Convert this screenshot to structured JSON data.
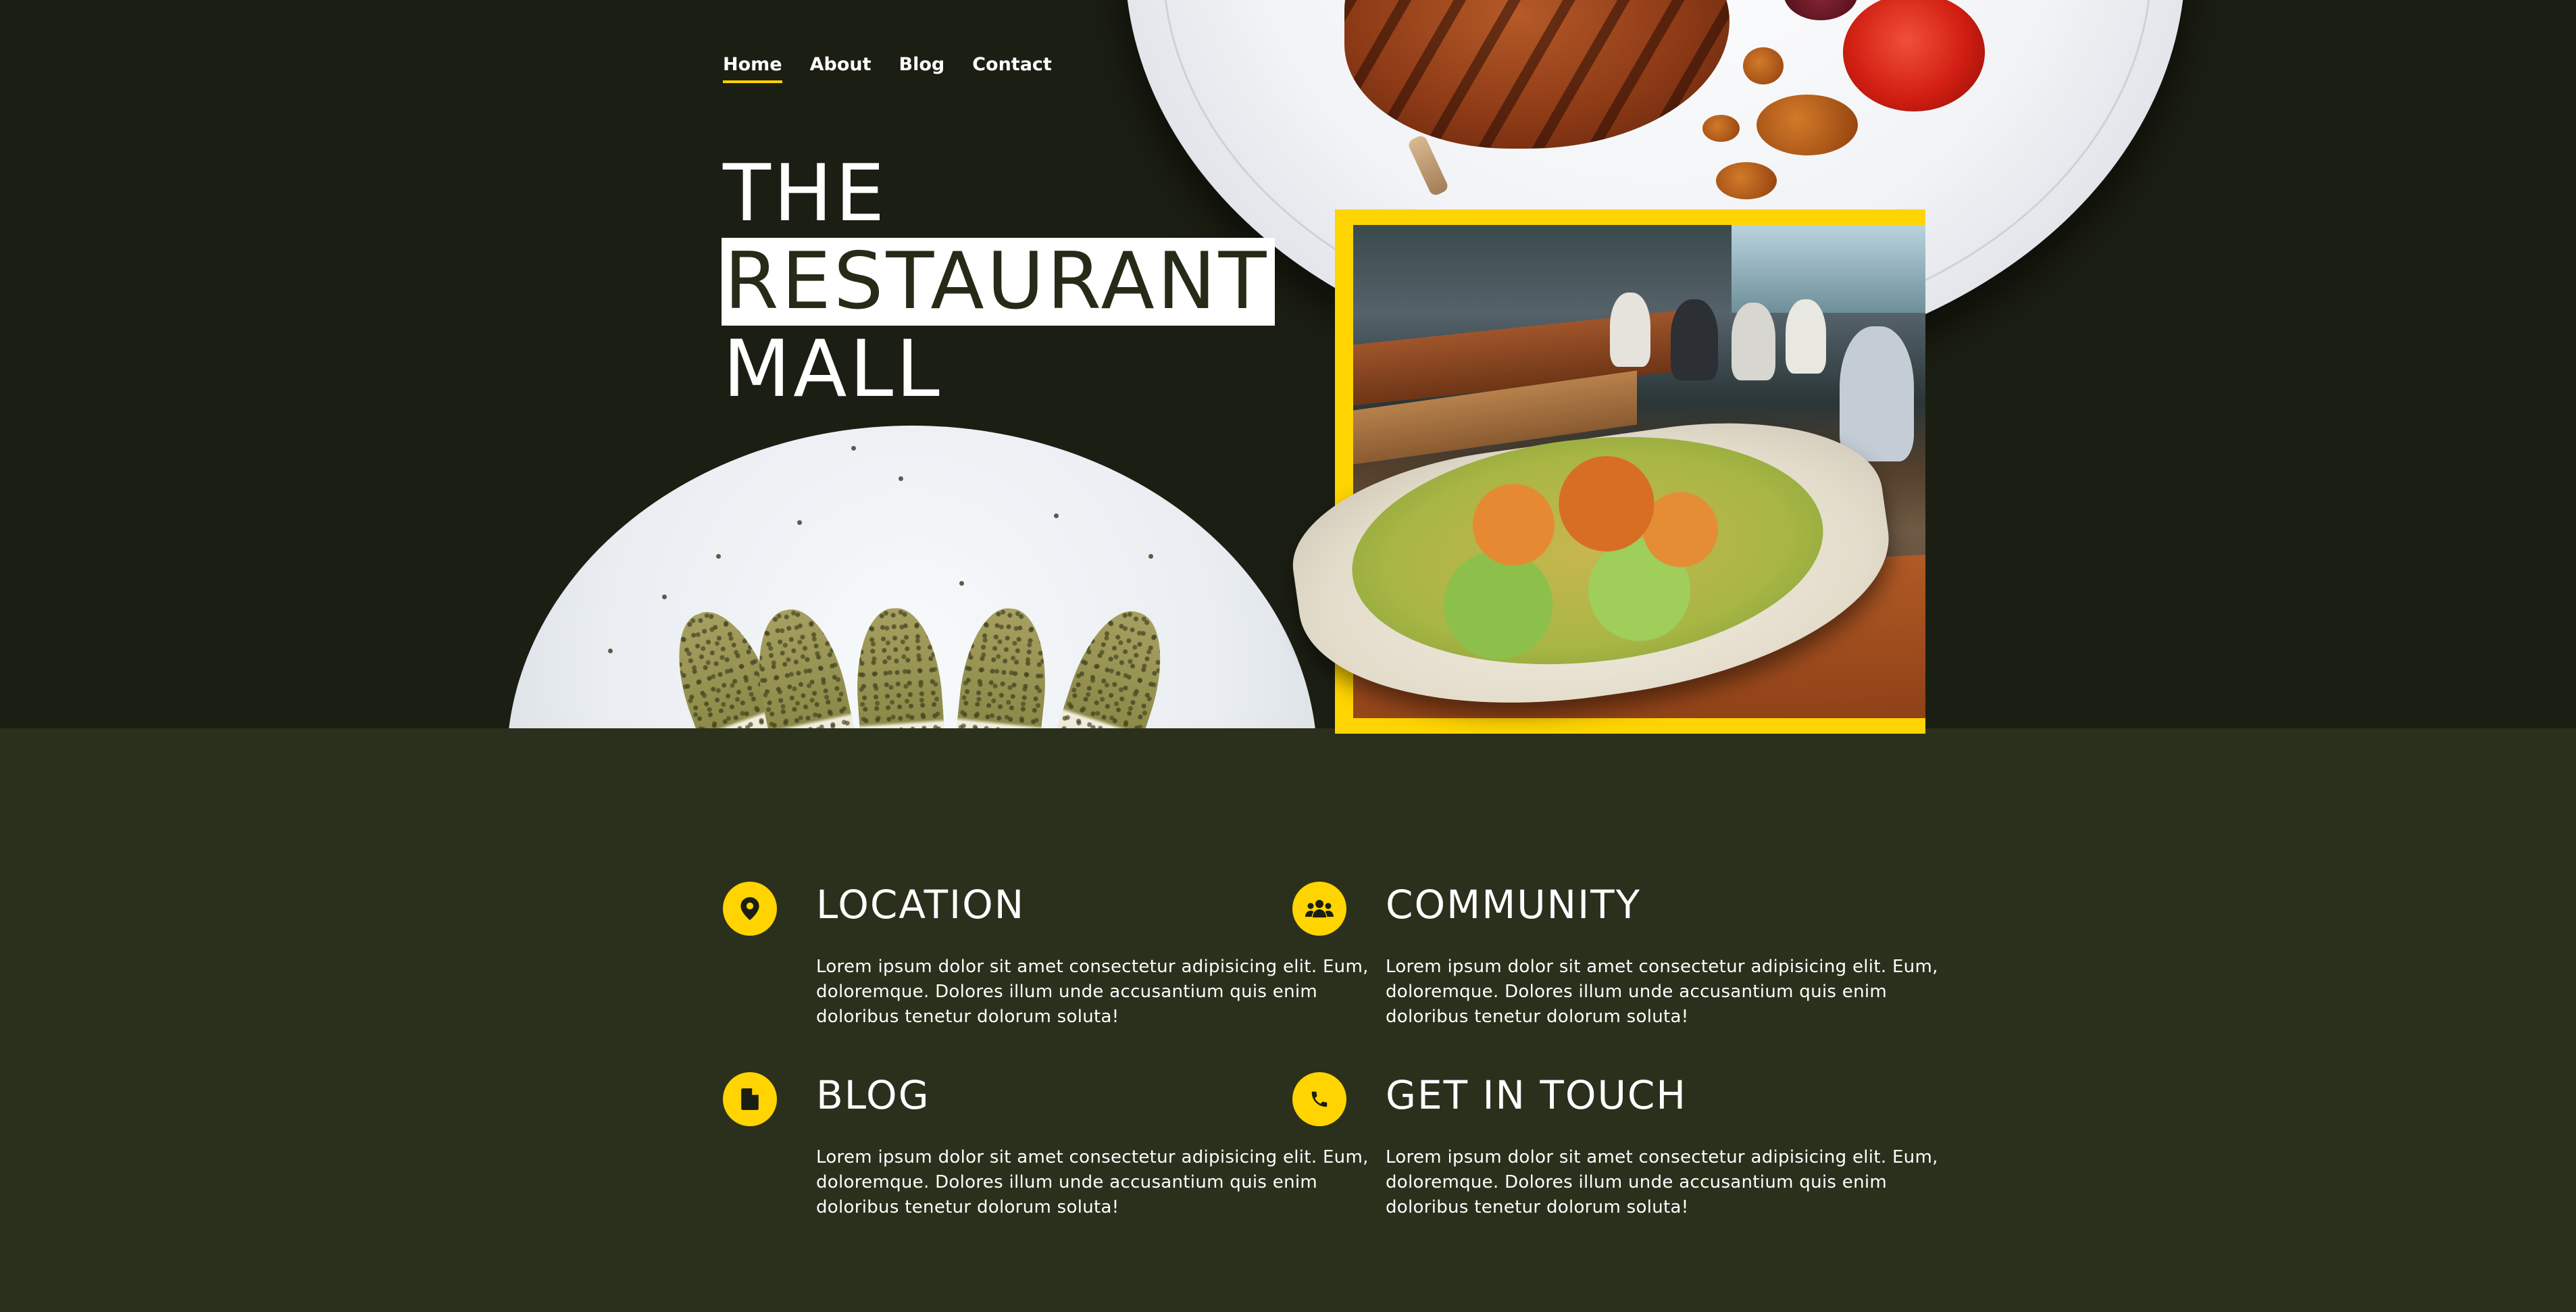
{
  "nav": {
    "items": [
      {
        "label": "Home",
        "active": true
      },
      {
        "label": "About"
      },
      {
        "label": "Blog"
      },
      {
        "label": "Contact"
      }
    ]
  },
  "hero": {
    "title_line1": "THE",
    "title_line2": "RESTAURANT",
    "title_line3": "MALL"
  },
  "features": [
    {
      "icon": "map-pin-icon",
      "title": "LOCATION",
      "text": "Lorem ipsum dolor sit amet consectetur adipisicing elit. Eum, doloremque. Dolores illum unde accusantium quis enim doloribus tenetur dolorum soluta!"
    },
    {
      "icon": "users-icon",
      "title": "COMMUNITY",
      "text": "Lorem ipsum dolor sit amet consectetur adipisicing elit. Eum, doloremque. Dolores illum unde accusantium quis enim doloribus tenetur dolorum soluta!"
    },
    {
      "icon": "file-icon",
      "title": "BLOG",
      "text": "Lorem ipsum dolor sit amet consectetur adipisicing elit. Eum, doloremque. Dolores illum unde accusantium quis enim doloribus tenetur dolorum soluta!"
    },
    {
      "icon": "phone-icon",
      "title": "GET IN TOUCH",
      "text": "Lorem ipsum dolor sit amet consectetur adipisicing elit. Eum, doloremque. Dolores illum unde accusantium quis enim doloribus tenetur dolorum soluta!"
    }
  ],
  "colors": {
    "hero_bg": "#1b1e12",
    "section_bg": "#2a301c",
    "accent": "#ffd400",
    "text": "#ffffff"
  }
}
